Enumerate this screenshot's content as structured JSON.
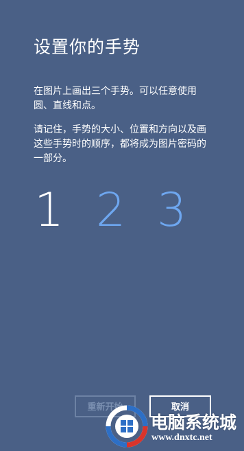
{
  "dialog": {
    "title": "设置你的手势",
    "paragraph1": "在图片上画出三个手势。可以任意使用圆、直线和点。",
    "paragraph2": "请记住，手势的大小、位置和方向以及画这些手势时的顺序，都将成为图片密码的一部分。"
  },
  "gesture_steps": [
    {
      "label": "1",
      "state": "current"
    },
    {
      "label": "2",
      "state": "pending"
    },
    {
      "label": "3",
      "state": "pending"
    }
  ],
  "buttons": {
    "restart_label": "重新开始",
    "cancel_label": "取消"
  },
  "watermark": {
    "site_name": "电脑系统城",
    "url": "www.dnxtc.net"
  },
  "colors": {
    "background": "#4a6086",
    "current_step": "#ffffff",
    "pending_step": "#6ea7f0",
    "disabled_button": "#7a8fb0",
    "watermark_logo_blue": "#2d6fc6",
    "watermark_logo_red": "#d9342b"
  }
}
